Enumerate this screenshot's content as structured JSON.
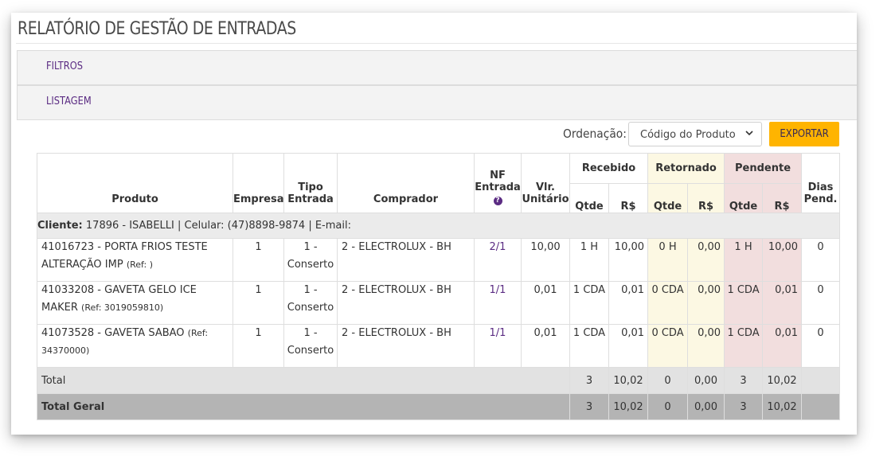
{
  "page": {
    "title": "RELATÓRIO DE GESTÃO DE ENTRADAS"
  },
  "panels": {
    "filters_label": "FILTROS",
    "list_label": "LISTAGEM"
  },
  "toolbar": {
    "order_label": "Ordenação:",
    "order_value": "Código do Produto",
    "export_label": "EXPORTAR"
  },
  "colors": {
    "accent": "#5b2c83",
    "export_button": "#ffb400",
    "retornado_bg": "#fcf8e3",
    "pendente_bg": "#f2dede",
    "total_bg": "#e2e2e2",
    "grand_total_bg": "#b4b4b4"
  },
  "table": {
    "headers": {
      "produto": "Produto",
      "empresa": "Empresa",
      "tipo_entrada": [
        "Tipo",
        "Entrada"
      ],
      "comprador": "Comprador",
      "nf_entrada": [
        "NF",
        "Entrada"
      ],
      "vlr_unitario": [
        "Vlr.",
        "Unitário"
      ],
      "recebido": "Recebido",
      "retornado": "Retornado",
      "pendente": "Pendente",
      "dias_pend": [
        "Dias",
        "Pend."
      ],
      "qtde": "Qtde",
      "rs": "R$"
    },
    "client": {
      "label": "Cliente:",
      "info": " 17896 - ISABELLI | Celular: (47)8898-9874 | E-mail:"
    },
    "rows": [
      {
        "produto": "41016723 - PORTA FRIOS TESTE ALTERAÇÃO IMP",
        "ref": "(Ref: )",
        "empresa": "1",
        "tipo": "1 - Conserto",
        "comprador": "2 - ELECTROLUX - BH",
        "nf": "2/1",
        "vlr": "10,00",
        "rec_qtde": "1 H",
        "rec_rs": "10,00",
        "ret_qtde": "0 H",
        "ret_rs": "0,00",
        "pen_qtde": "1 H",
        "pen_rs": "10,00",
        "dias": "0"
      },
      {
        "produto": "41033208 - GAVETA GELO ICE MAKER",
        "ref": "(Ref: 3019059810)",
        "empresa": "1",
        "tipo": "1 - Conserto",
        "comprador": "2 - ELECTROLUX - BH",
        "nf": "1/1",
        "vlr": "0,01",
        "rec_qtde": "1 CDA",
        "rec_rs": "0,01",
        "ret_qtde": "0 CDA",
        "ret_rs": "0,00",
        "pen_qtde": "1 CDA",
        "pen_rs": "0,01",
        "dias": "0"
      },
      {
        "produto": "41073528 - GAVETA SABAO",
        "ref": "(Ref: 34370000)",
        "empresa": "1",
        "tipo": "1 - Conserto",
        "comprador": "2 - ELECTROLUX - BH",
        "nf": "1/1",
        "vlr": "0,01",
        "rec_qtde": "1 CDA",
        "rec_rs": "0,01",
        "ret_qtde": "0 CDA",
        "ret_rs": "0,00",
        "pen_qtde": "1 CDA",
        "pen_rs": "0,01",
        "dias": "0"
      }
    ],
    "total": {
      "label": "Total",
      "rec_qtde": "3",
      "rec_rs": "10,02",
      "ret_qtde": "0",
      "ret_rs": "0,00",
      "pen_qtde": "3",
      "pen_rs": "10,02"
    },
    "grand_total": {
      "label": "Total Geral",
      "rec_qtde": "3",
      "rec_rs": "10,02",
      "ret_qtde": "0",
      "ret_rs": "0,00",
      "pen_qtde": "3",
      "pen_rs": "10,02"
    }
  }
}
